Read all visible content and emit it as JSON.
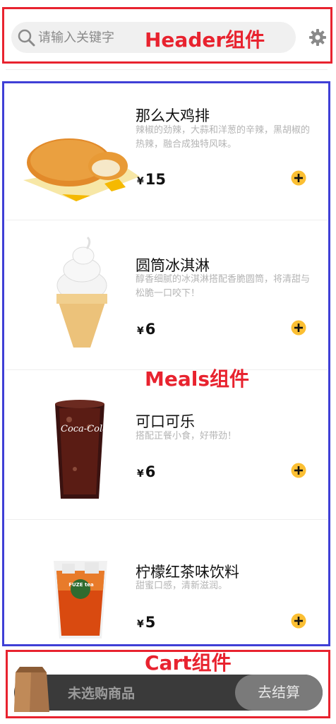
{
  "header": {
    "search_placeholder": "请输入关键字",
    "label": "Header组件"
  },
  "meals": {
    "label": "Meals组件",
    "currency": "¥",
    "items": [
      {
        "name": "那么大鸡排",
        "desc": "辣椒的劲辣，大蒜和洋葱的辛辣，黑胡椒的热辣，融合成独特风味。",
        "price": "15"
      },
      {
        "name": "圆筒冰淇淋",
        "desc": "醇香细腻的冰淇淋搭配香脆圆筒，将清甜与松脆一口咬下！",
        "price": "6"
      },
      {
        "name": "可口可乐",
        "desc": "搭配正餐小食，好带劲！",
        "price": "6"
      },
      {
        "name": "柠檬红茶味饮料",
        "desc": "甜蜜口感，清新滋润。",
        "price": "5"
      }
    ]
  },
  "cart": {
    "label": "Cart组件",
    "empty_text": "未选购商品",
    "checkout_label": "去结算"
  },
  "colors": {
    "accent_yellow": "#fbbf33",
    "outline_red": "#e8232f",
    "outline_blue": "#3f3fd6"
  },
  "icons": [
    "search-icon",
    "gear-icon",
    "add-icon",
    "shopping-bag-icon"
  ],
  "images": {
    "cola_logo_text": "Coca-Cola",
    "tea_logo_text": "FUZE tea"
  }
}
